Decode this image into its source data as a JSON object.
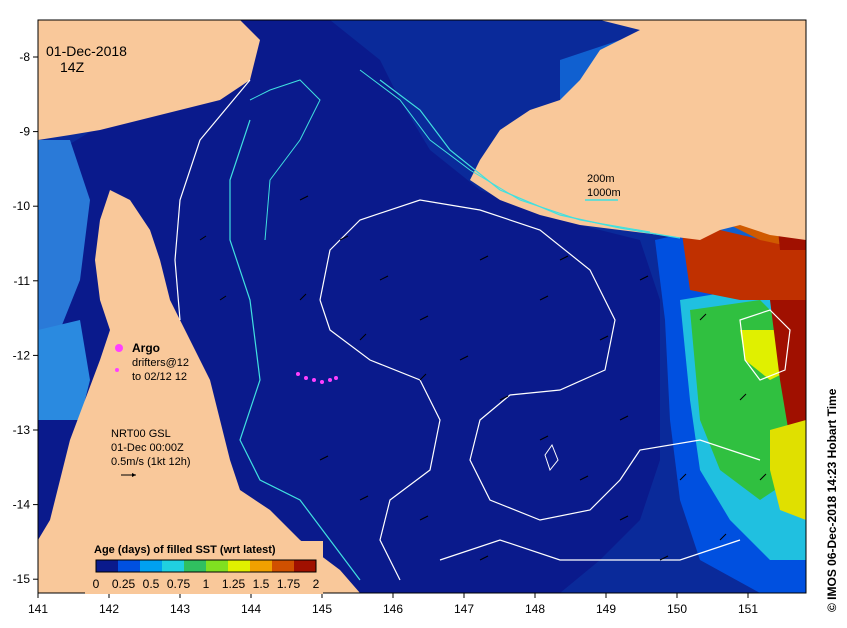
{
  "header": {
    "date": "01-Dec-2018",
    "time": "14Z"
  },
  "annotations": {
    "isobath_200": "200m",
    "isobath_1000": "1000m",
    "argo_title": "Argo",
    "argo_line1": "drifters@12",
    "argo_line2": "to 02/12 12",
    "current_line1": "NRT00 GSL",
    "current_line2": "01-Dec 00:00Z",
    "current_line3": "0.5m/s (1kt 12h)"
  },
  "colorbar": {
    "title": "Age (days) of filled SST (wrt latest)",
    "ticks": [
      "0",
      "0.25",
      "0.5",
      "0.75",
      "1",
      "1.25",
      "1.5",
      "1.75",
      "2"
    ],
    "colors": [
      "#0a1a8c",
      "#0050e0",
      "#00a0f0",
      "#20d0e0",
      "#30c060",
      "#80e020",
      "#e0f000",
      "#f0a000",
      "#d05000",
      "#a01000"
    ]
  },
  "axes": {
    "x_ticks": [
      "141",
      "142",
      "143",
      "144",
      "145",
      "146",
      "147",
      "148",
      "149",
      "150",
      "151"
    ],
    "y_ticks": [
      "-8",
      "-9",
      "-10",
      "-11",
      "-12",
      "-13",
      "-14",
      "-15"
    ]
  },
  "credit": "© IMOS 06-Dec-2018 14:23 Hobart Time",
  "colors": {
    "land": "#f9c89a",
    "ocean_deep": "#0a1a8c",
    "ocean_mid": "#0a3aa8",
    "coast_light": "#2a8ad8",
    "contour": "#ffffff",
    "isobath": "#40e0e0",
    "argo": "#ff40ff"
  }
}
